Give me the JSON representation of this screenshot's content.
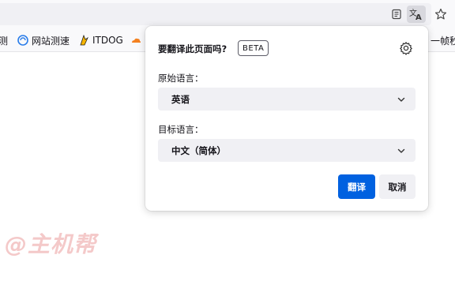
{
  "bookmarks": [
    {
      "label": "测"
    },
    {
      "label": "网站测速"
    },
    {
      "label": "ITDOG"
    },
    {
      "label": "一帧秒"
    }
  ],
  "watermark": "@主机帮",
  "panel": {
    "title": "要翻译此页面吗?",
    "beta_badge": "BETA",
    "from_label": "原始语言：",
    "from_value": "英语",
    "to_label": "目标语言：",
    "to_value": "中文（简体）",
    "translate_button": "翻译",
    "cancel_button": "取消"
  },
  "colors": {
    "primary_button": "#0061e0",
    "select_bg": "#f0f0f4"
  }
}
